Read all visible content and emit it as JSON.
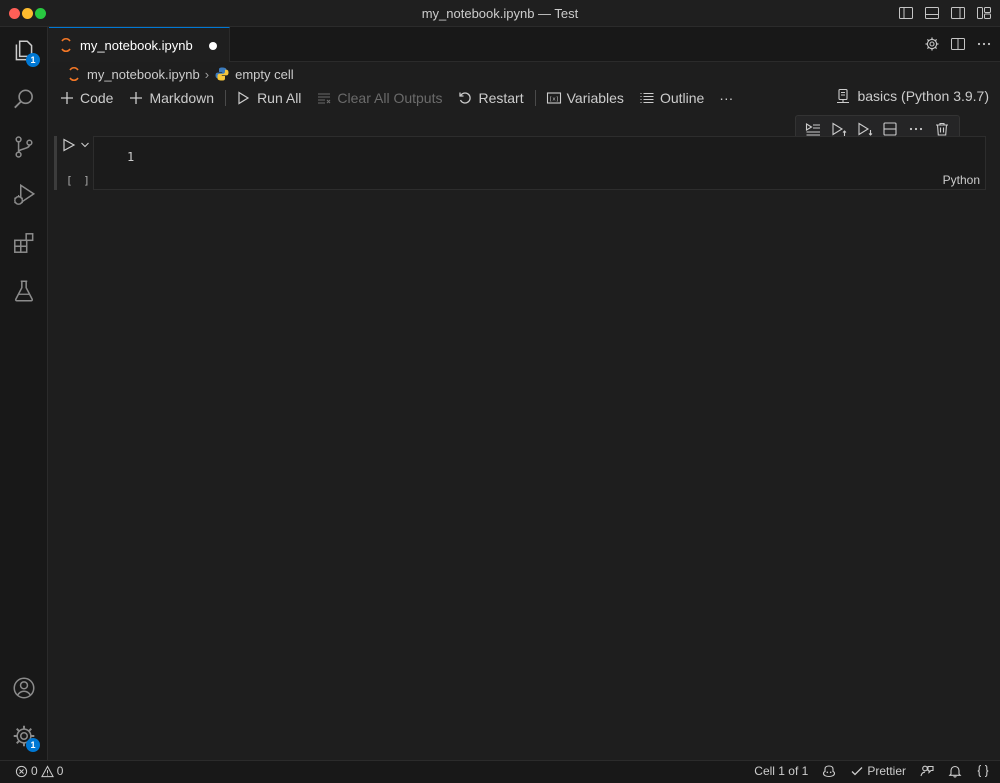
{
  "window": {
    "title": "my_notebook.ipynb — Test",
    "controls": [
      "close",
      "minimize",
      "zoom"
    ],
    "layout_icons": [
      "toggle-primary-sidebar-icon",
      "toggle-panel-icon",
      "toggle-secondary-sidebar-icon",
      "customize-layout-icon"
    ]
  },
  "activity_bar": {
    "items": [
      {
        "name": "explorer",
        "badge": "1"
      },
      {
        "name": "search"
      },
      {
        "name": "source-control"
      },
      {
        "name": "run-and-debug"
      },
      {
        "name": "extensions"
      },
      {
        "name": "testing"
      }
    ],
    "bottom": [
      {
        "name": "accounts"
      },
      {
        "name": "manage",
        "badge": "1"
      }
    ]
  },
  "tab": {
    "label": "my_notebook.ipynb",
    "modified": true
  },
  "breadcrumb": {
    "file": "my_notebook.ipynb",
    "section": "empty cell"
  },
  "toolbar": {
    "code": "Code",
    "markdown": "Markdown",
    "run_all": "Run All",
    "clear_outputs": "Clear All Outputs",
    "restart": "Restart",
    "variables": "Variables",
    "outline": "Outline",
    "more": "···",
    "kernel": "basics (Python 3.9.7)"
  },
  "cell": {
    "line_number": "1",
    "execution_status": "[ ]",
    "language": "Python"
  },
  "status_bar": {
    "errors": "0",
    "warnings": "0",
    "cell_position": "Cell 1 of 1",
    "prettier": "Prettier"
  },
  "colors": {
    "accent": "#0078d4",
    "background": "#1e1e1e",
    "sidebar": "#181818",
    "jupyter_orange": "#f37726"
  }
}
